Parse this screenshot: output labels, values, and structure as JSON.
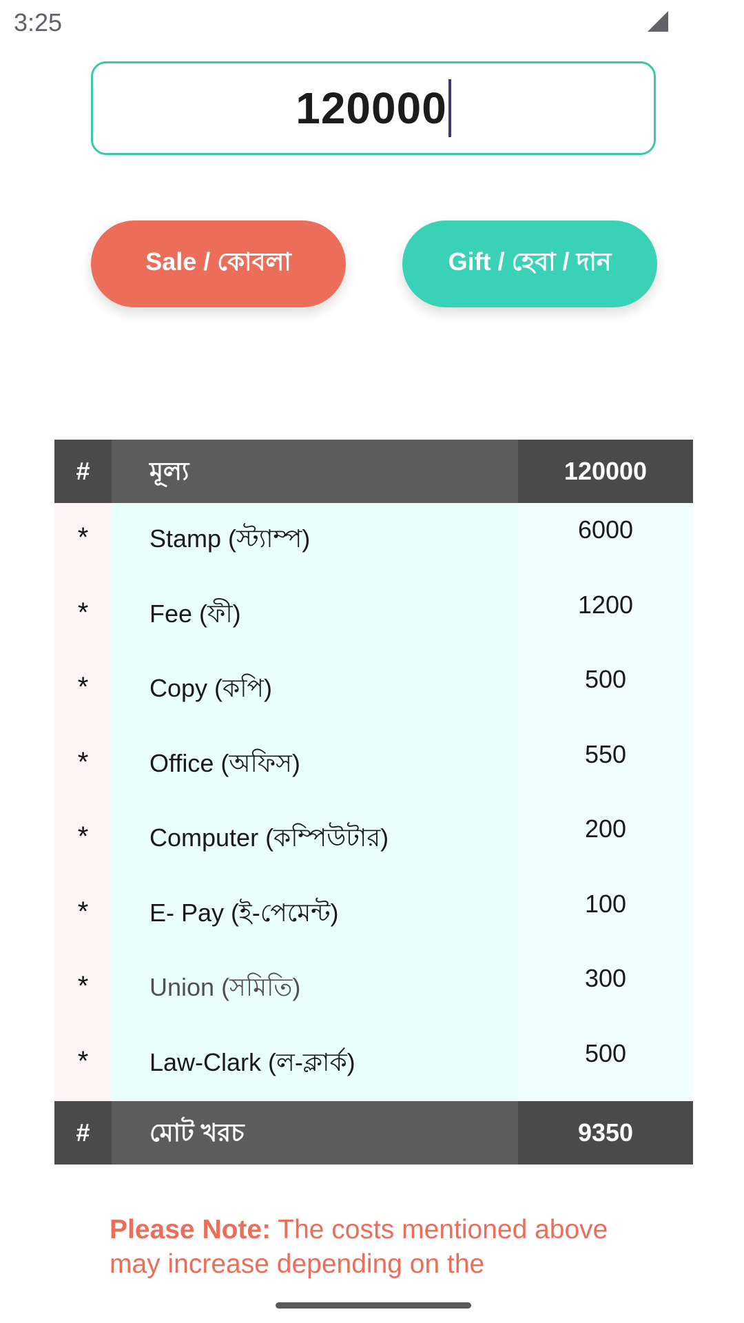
{
  "status_bar": {
    "time": "3:25",
    "signal_icon": "cell-signal-icon"
  },
  "amount_input": {
    "value": "120000"
  },
  "buttons": {
    "sale_label": "Sale / কোবলা",
    "gift_label": "Gift / হেবা / দান"
  },
  "table": {
    "header": {
      "hash": "#",
      "label": "মূল্য",
      "value": "120000"
    },
    "rows": [
      {
        "marker": "*",
        "label": "Stamp (স্ট্যাম্প)",
        "value": "6000"
      },
      {
        "marker": "*",
        "label": "Fee (ফী)",
        "value": "1200"
      },
      {
        "marker": "*",
        "label": "Copy (কপি)",
        "value": "500"
      },
      {
        "marker": "*",
        "label": "Office (অফিস)",
        "value": "550"
      },
      {
        "marker": "*",
        "label": "Computer (কম্পিউটার)",
        "value": "200"
      },
      {
        "marker": "*",
        "label": "E- Pay (ই-পেমেন্ট)",
        "value": "100"
      },
      {
        "marker": "*",
        "label": "Union (সমিতি)",
        "value": "300"
      },
      {
        "marker": "*",
        "label": "Law-Clark (ল-ক্লার্ক)",
        "value": "500"
      }
    ],
    "footer": {
      "hash": "#",
      "label": "মোট খরচ",
      "value": "9350"
    }
  },
  "note": {
    "prefix": "Please Note:",
    "text": " The costs mentioned above may increase depending on the"
  },
  "colors": {
    "accent_teal": "#3ad2b6",
    "accent_coral": "#ea6e5a",
    "table_dark": "#4a4a4a"
  }
}
